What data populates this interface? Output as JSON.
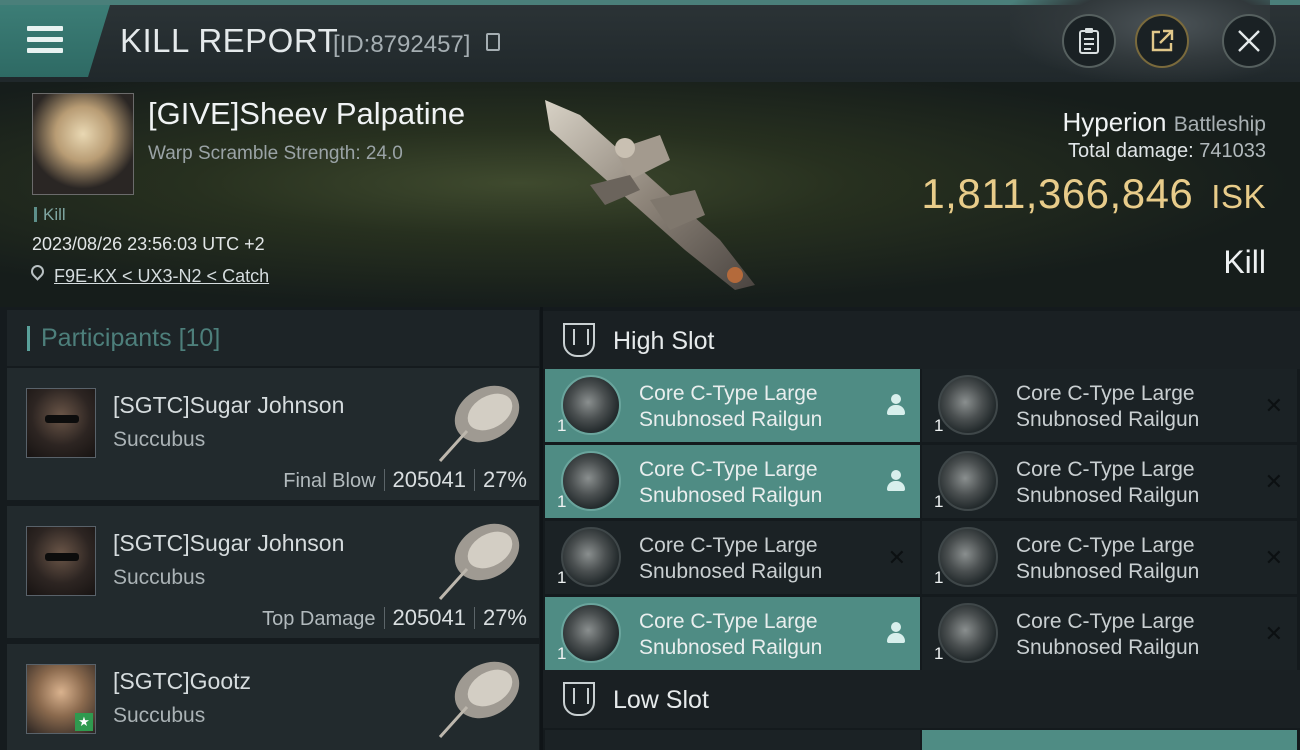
{
  "header": {
    "title": "KILL REPORT",
    "report_id": "[ID:8792457]",
    "icons": [
      "menu-icon",
      "copy-icon",
      "clipboard-icon",
      "share-icon",
      "close-icon"
    ]
  },
  "victim": {
    "name": "[GIVE]Sheev Palpatine",
    "warp_scramble": "Warp Scramble Strength: 24.0",
    "tag": "Kill",
    "datetime": "2023/08/26 23:56:03 UTC +2",
    "location": "F9E-KX < UX3-N2 < Catch",
    "ship_name": "Hyperion",
    "ship_class": "Battleship",
    "total_damage_label": "Total damage:",
    "total_damage": "741033",
    "isk_value": "1,811,366,846",
    "isk_unit": "ISK",
    "result": "Kill"
  },
  "participants": {
    "title": "Participants",
    "count": "[10]",
    "items": [
      {
        "name": "[SGTC]Sugar Johnson",
        "ship": "Succubus",
        "label": "Final Blow",
        "damage": "205041",
        "percent": "27%"
      },
      {
        "name": "[SGTC]Sugar Johnson",
        "ship": "Succubus",
        "label": "Top Damage",
        "damage": "205041",
        "percent": "27%"
      },
      {
        "name": "[SGTC]Gootz",
        "ship": "Succubus",
        "label": "",
        "damage": "",
        "percent": ""
      }
    ]
  },
  "slots": {
    "high": {
      "title": "High Slot",
      "modules": [
        {
          "name1": "Core C-Type Large",
          "name2": "Snubnosed Railgun",
          "qty": "1",
          "state": "active"
        },
        {
          "name1": "Core C-Type Large",
          "name2": "Snubnosed Railgun",
          "qty": "1",
          "state": "destroyed"
        },
        {
          "name1": "Core C-Type Large",
          "name2": "Snubnosed Railgun",
          "qty": "1",
          "state": "active"
        },
        {
          "name1": "Core C-Type Large",
          "name2": "Snubnosed Railgun",
          "qty": "1",
          "state": "destroyed"
        },
        {
          "name1": "Core C-Type Large",
          "name2": "Snubnosed Railgun",
          "qty": "1",
          "state": "destroyed"
        },
        {
          "name1": "Core C-Type Large",
          "name2": "Snubnosed Railgun",
          "qty": "1",
          "state": "destroyed"
        },
        {
          "name1": "Core C-Type Large",
          "name2": "Snubnosed Railgun",
          "qty": "1",
          "state": "active"
        },
        {
          "name1": "Core C-Type Large",
          "name2": "Snubnosed Railgun",
          "qty": "1",
          "state": "destroyed"
        }
      ]
    },
    "low": {
      "title": "Low Slot"
    }
  },
  "colors": {
    "accent": "#4f8c84",
    "isk_gold": "#e8cc8a",
    "header_bg": "#2b3336",
    "panel_bg": "#222a2d"
  }
}
